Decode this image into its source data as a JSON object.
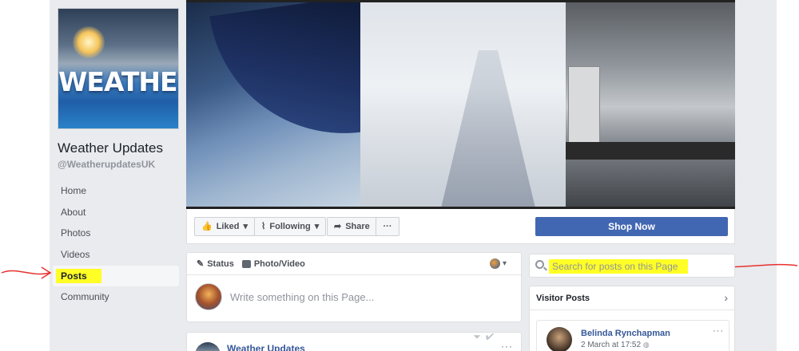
{
  "page": {
    "name": "Weather Updates",
    "handle": "@WeatherupdatesUK",
    "profile_logo_text": "WEATHER"
  },
  "sidebar": {
    "items": [
      {
        "label": "Home"
      },
      {
        "label": "About"
      },
      {
        "label": "Photos"
      },
      {
        "label": "Videos"
      },
      {
        "label": "Posts",
        "active": true,
        "highlighted": true
      },
      {
        "label": "Community"
      }
    ]
  },
  "actions": {
    "liked_label": "Liked",
    "following_label": "Following",
    "share_label": "Share",
    "more_label": "···",
    "shop_label": "Shop Now"
  },
  "composer": {
    "status_label": "Status",
    "photo_video_label": "Photo/Video",
    "placeholder": "Write something on this Page..."
  },
  "post": {
    "author": "Weather Updates",
    "more_label": "···"
  },
  "search": {
    "placeholder": "Search for posts on this Page",
    "highlighted": true
  },
  "visitor_posts": {
    "title": "Visitor Posts",
    "items": [
      {
        "author": "Belinda Rynchapman",
        "date": "2 March at 17:52",
        "more_label": "···"
      }
    ]
  },
  "annotations": {
    "arrow_color": "#e8312f",
    "highlight_color": "#ffff26"
  },
  "colors": {
    "brand_blue": "#4267b2",
    "link_blue": "#365899",
    "page_bg": "#e9ebee"
  }
}
